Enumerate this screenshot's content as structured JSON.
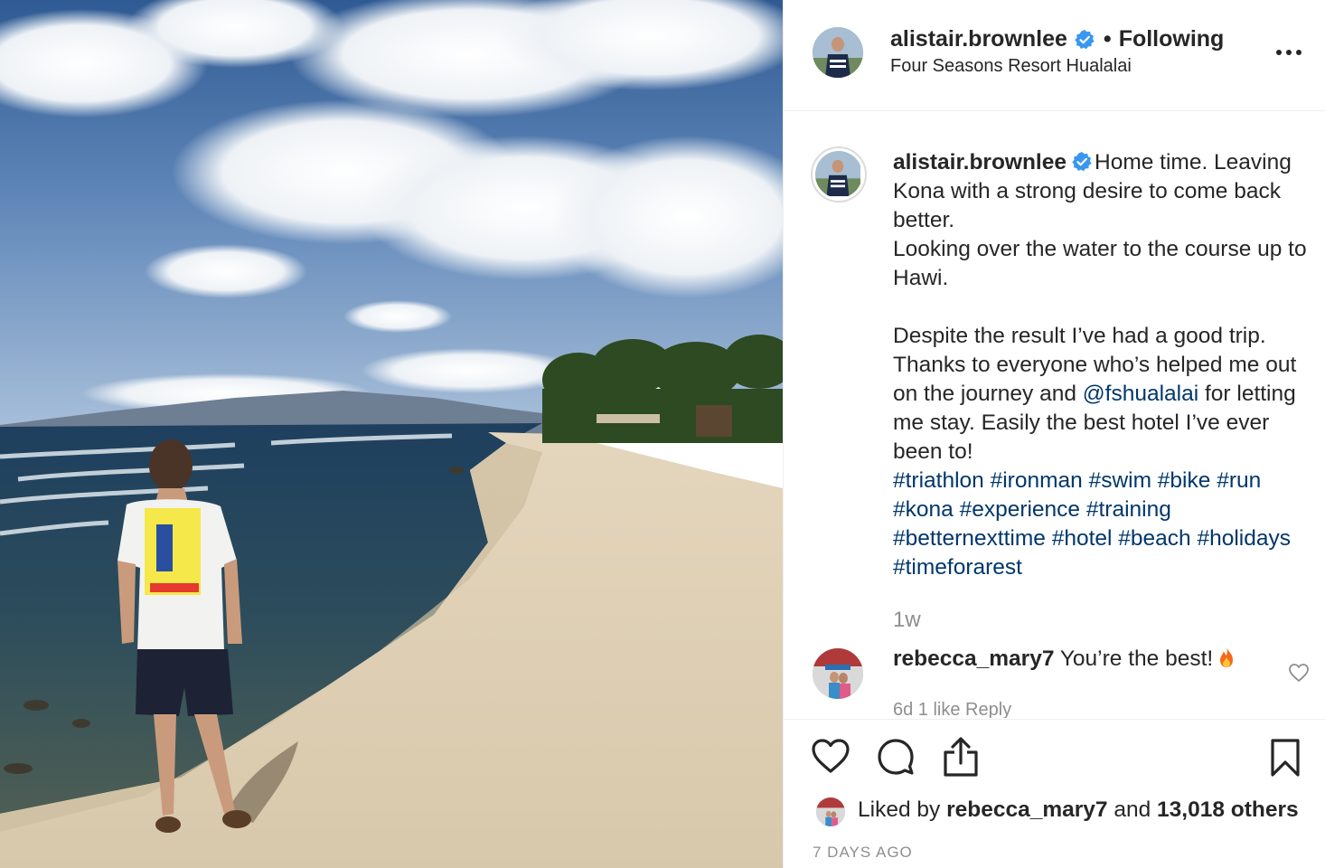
{
  "header": {
    "username": "alistair.brownlee",
    "follow_separator": "•",
    "follow_status": "Following",
    "location": "Four Seasons Resort Hualalai"
  },
  "caption": {
    "username": "alistair.brownlee",
    "line1_prefix": "Home time. Leaving Kona with a strong desire to come back better.",
    "line2": "Looking over the water to the course up to Hawi.",
    "para2_before": "Despite the result I’ve had a good trip. Thanks to everyone who’s helped me out on the journey and ",
    "mention": "@fshualalai",
    "para2_after": " for letting me stay. Easily the best hotel I’ve ever been to!",
    "hashtags": [
      "#triathlon",
      "#ironman",
      "#swim",
      "#bike",
      "#run",
      "#kona",
      "#experience",
      "#training",
      "#betternexttime",
      "#hotel",
      "#beach",
      "#holidays",
      "#timeforarest"
    ],
    "time_ago": "1w"
  },
  "comment": {
    "username": "rebecca_mary7",
    "text": "You’re the best!",
    "emoji_icon": "fire-icon",
    "meta": "6d   1 like   Reply"
  },
  "likes": {
    "prefix": "Liked by",
    "user": "rebecca_mary7",
    "middle": "and",
    "count": "13,018 others"
  },
  "date": "7 DAYS AGO",
  "icons": {
    "verified": "verified-badge-icon",
    "more": "more-options-icon",
    "like": "heart-icon",
    "comment": "comment-icon",
    "share": "share-icon",
    "save": "bookmark-icon"
  },
  "colors": {
    "verified_blue": "#3897f0",
    "link_blue": "#00376b",
    "muted_gray": "#8e8e8e",
    "text": "#262626"
  }
}
